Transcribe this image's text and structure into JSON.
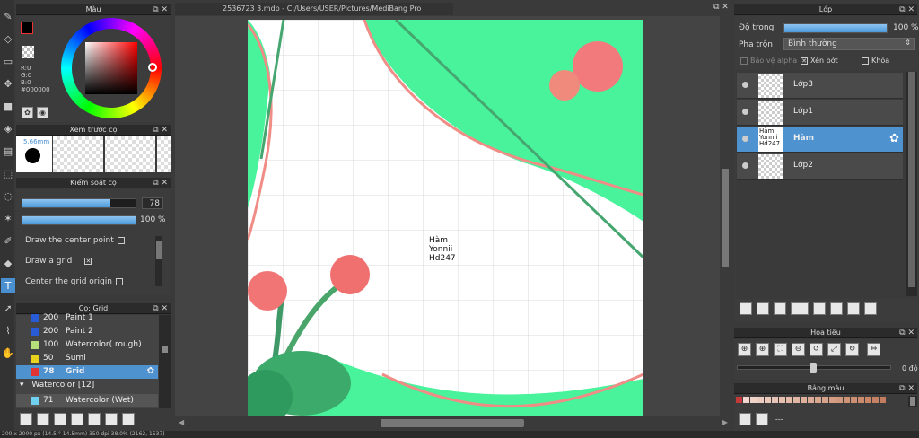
{
  "window": {
    "title": "2536723 3.mdp - C:/Users/USER/Pictures/MediBang Pro"
  },
  "tools": [
    "brush-tool",
    "eraser-tool",
    "rectangle-select-tool",
    "move-tool",
    "fill-rect-tool",
    "bucket-tool",
    "gradient-tool",
    "select-tool",
    "lasso-tool",
    "magic-wand-tool",
    "select-pen-tool",
    "select-eraser-tool",
    "text-tool",
    "operation-tool",
    "eyedropper-tool",
    "hand-tool"
  ],
  "color_panel": {
    "title": "Màu",
    "r": "R:0",
    "g": "G:0",
    "b": "B:0",
    "hex": "#000000",
    "fg_color": "#000000",
    "bg_color": "#f27a8a"
  },
  "brush_preview": {
    "title": "Xem trước cọ",
    "size": "5.66mm"
  },
  "brush_control": {
    "title": "Kiểm soát cọ",
    "size_value": "78",
    "opacity_value": "100 %",
    "size_fraction": 0.78,
    "opacity_fraction": 1.0,
    "options": [
      {
        "label": "Draw the center point",
        "checked": false
      },
      {
        "label": "Draw a grid",
        "checked": true
      },
      {
        "label": "Center the grid origin",
        "checked": false
      }
    ]
  },
  "brush_list": {
    "title": "Cọ: Grid",
    "items": [
      {
        "size": "200",
        "name": "Paint 1",
        "color": "#2a5bd7"
      },
      {
        "size": "200",
        "name": "Paint 2",
        "color": "#2a5bd7"
      },
      {
        "size": "100",
        "name": "Watercolor( rough)",
        "color": "#b6e07a"
      },
      {
        "size": "50",
        "name": "Sumi",
        "color": "#e8d21e"
      },
      {
        "size": "78",
        "name": "Grid",
        "color": "#e33434",
        "selected": true
      }
    ],
    "group": "Watercolor [12]",
    "group_item": {
      "size": "71",
      "name": "Watercolor (Wet)",
      "color": "#6fd0f0"
    }
  },
  "canvas": {
    "text_lines": [
      "Hàm",
      "Yonnii",
      "Hd247"
    ]
  },
  "layer_panel": {
    "title": "Lớp",
    "opacity_label": "Độ trong",
    "opacity_value": "100 %",
    "opacity_fraction": 1.0,
    "blend_label": "Pha trộn",
    "blend_value": "Bình thường",
    "protect_alpha": "Bảo vệ alpha",
    "clipping": "Xén bớt",
    "lock": "Khóa",
    "layers": [
      {
        "name": "Lớp3",
        "selected": false
      },
      {
        "name": "Lớp1",
        "selected": false
      },
      {
        "name": "Hàm",
        "selected": true,
        "thumb_text": [
          "Hàm",
          "Yonnii",
          "Hd247"
        ]
      },
      {
        "name": "Lớp2",
        "selected": false
      }
    ]
  },
  "navigator": {
    "title": "Hoa tiêu",
    "rotation": "0 độ",
    "zoom_fraction": 0.47
  },
  "palette_panel": {
    "title": "Bảng màu",
    "swatches": [
      "#c43a3a",
      "#f3d6cf",
      "#f0d2c9",
      "#eccbc1",
      "#ebc9bd",
      "#e8c4b6",
      "#e6bfae",
      "#e4baa8",
      "#e1b6a2",
      "#deb09b",
      "#dcab95",
      "#d9a790",
      "#d7a28a",
      "#d49d84",
      "#d1987e",
      "#cf9378",
      "#cd8f73",
      "#ca8a6d",
      "#c88568",
      "#c58163",
      "#c37d5e"
    ],
    "footer_label": "---"
  },
  "status": {
    "text": "200 x 2000 px (14.5 ° 14.5mm)  350 dpi  38.0%  (2162, 1537)"
  }
}
